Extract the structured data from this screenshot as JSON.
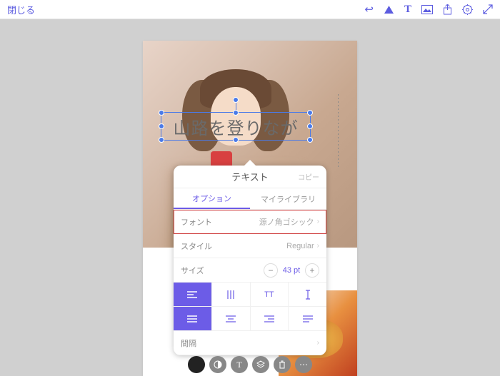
{
  "topbar": {
    "close": "閉じる"
  },
  "text_layer": {
    "content": "山路を登りなが"
  },
  "panel": {
    "title": "テキスト",
    "copy": "コピー",
    "tabs": {
      "options": "オプション",
      "library": "マイライブラリ"
    },
    "font": {
      "label": "フォント",
      "value": "源ノ角ゴシック"
    },
    "style": {
      "label": "スタイル",
      "value": "Regular"
    },
    "size": {
      "label": "サイズ",
      "value": "43 pt"
    },
    "spacing": {
      "label": "間隔"
    }
  }
}
